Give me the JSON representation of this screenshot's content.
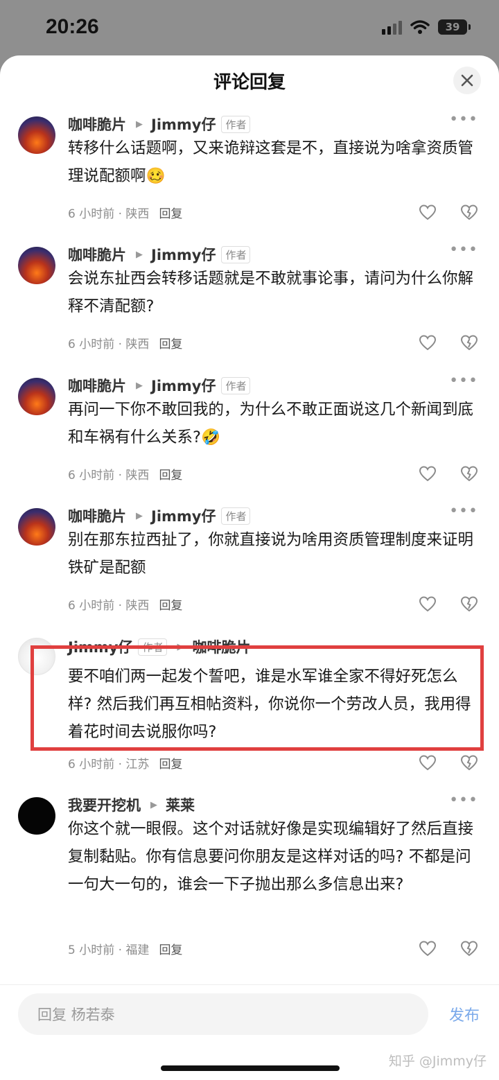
{
  "status_bar": {
    "time": "20:26",
    "battery": "39"
  },
  "header": {
    "title": "评论回复"
  },
  "comments": [
    {
      "author": "咖啡脆片",
      "reply_to": "Jimmy仔",
      "reply_to_tag": "作者",
      "text": "转移什么话题啊，又来诡辩这套是不，直接说为啥拿资质管理说配额啊",
      "emoji": "🥴",
      "time": "6 小时前 · 陕西",
      "reply_label": "回复"
    },
    {
      "author": "咖啡脆片",
      "reply_to": "Jimmy仔",
      "reply_to_tag": "作者",
      "text": "会说东扯西会转移话题就是不敢就事论事，请问为什么你解释不清配额?",
      "time": "6 小时前 · 陕西",
      "reply_label": "回复"
    },
    {
      "author": "咖啡脆片",
      "reply_to": "Jimmy仔",
      "reply_to_tag": "作者",
      "text": "再问一下你不敢回我的，为什么不敢正面说这几个新闻到底和车祸有什么关系?",
      "emoji": "🤣",
      "time": "6 小时前 · 陕西",
      "reply_label": "回复"
    },
    {
      "author": "咖啡脆片",
      "reply_to": "Jimmy仔",
      "reply_to_tag": "作者",
      "text": "别在那东拉西扯了，你就直接说为啥用资质管理制度来证明铁矿是配额",
      "time": "6 小时前 · 陕西",
      "reply_label": "回复"
    },
    {
      "author": "Jimmy仔",
      "author_tag": "作者",
      "reply_to": "咖啡脆片",
      "text": "要不咱们两一起发个誓吧，谁是水军谁全家不得好死怎么样? 然后我们再互相帖资料，你说你一个劳改人员，我用得着花时间去说服你吗?",
      "time": "6 小时前 · 江苏",
      "reply_label": "回复"
    },
    {
      "author": "我要开挖机",
      "reply_to": "莱莱",
      "text": "你这个就一眼假。这个对话就好像是实现编辑好了然后直接复制黏贴。你有信息要问你朋友是这样对话的吗? 不都是问一句大一句的，谁会一下子抛出那么多信息出来?",
      "time": "5 小时前 · 福建",
      "reply_label": "回复"
    }
  ],
  "bottom": {
    "reply_placeholder": "回复 杨若泰",
    "publish_label": "发布",
    "watermark": "知乎 @Jimmy仔"
  }
}
